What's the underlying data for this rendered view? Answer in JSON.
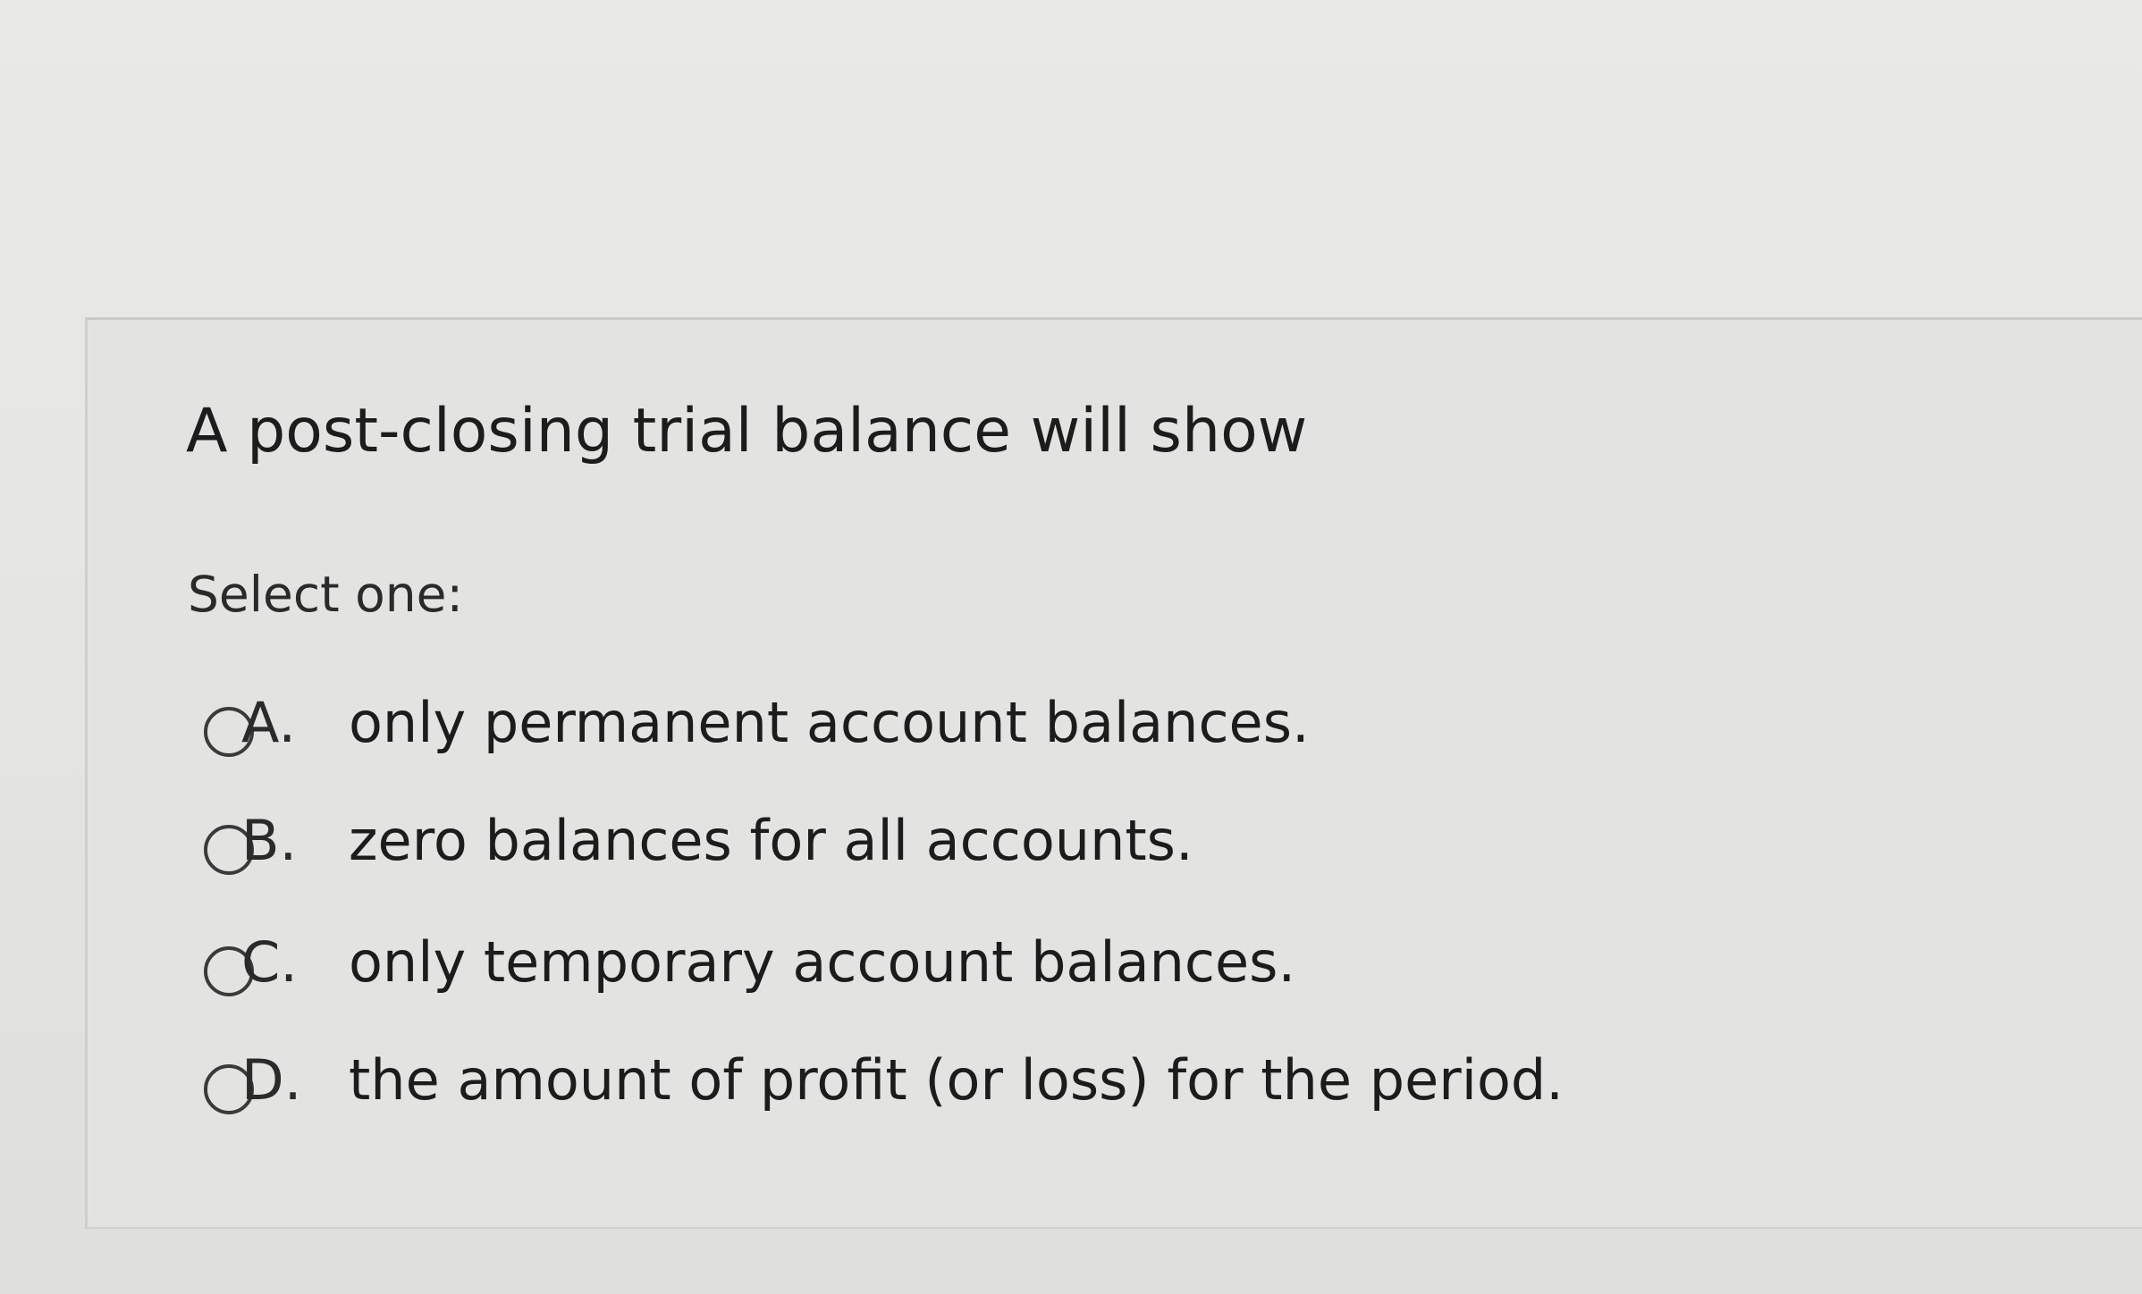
{
  "question": {
    "text": "A post-closing trial balance will show",
    "prompt": "Select one:"
  },
  "options": [
    {
      "letter": "A.",
      "text": "only permanent account balances.",
      "selected": false
    },
    {
      "letter": "B.",
      "text": "zero balances for all accounts.",
      "selected": false
    },
    {
      "letter": "C.",
      "text": "only temporary account balances.",
      "selected": false
    },
    {
      "letter": "D.",
      "text": "the amount of profit (or loss) for the period.",
      "selected": false
    }
  ]
}
